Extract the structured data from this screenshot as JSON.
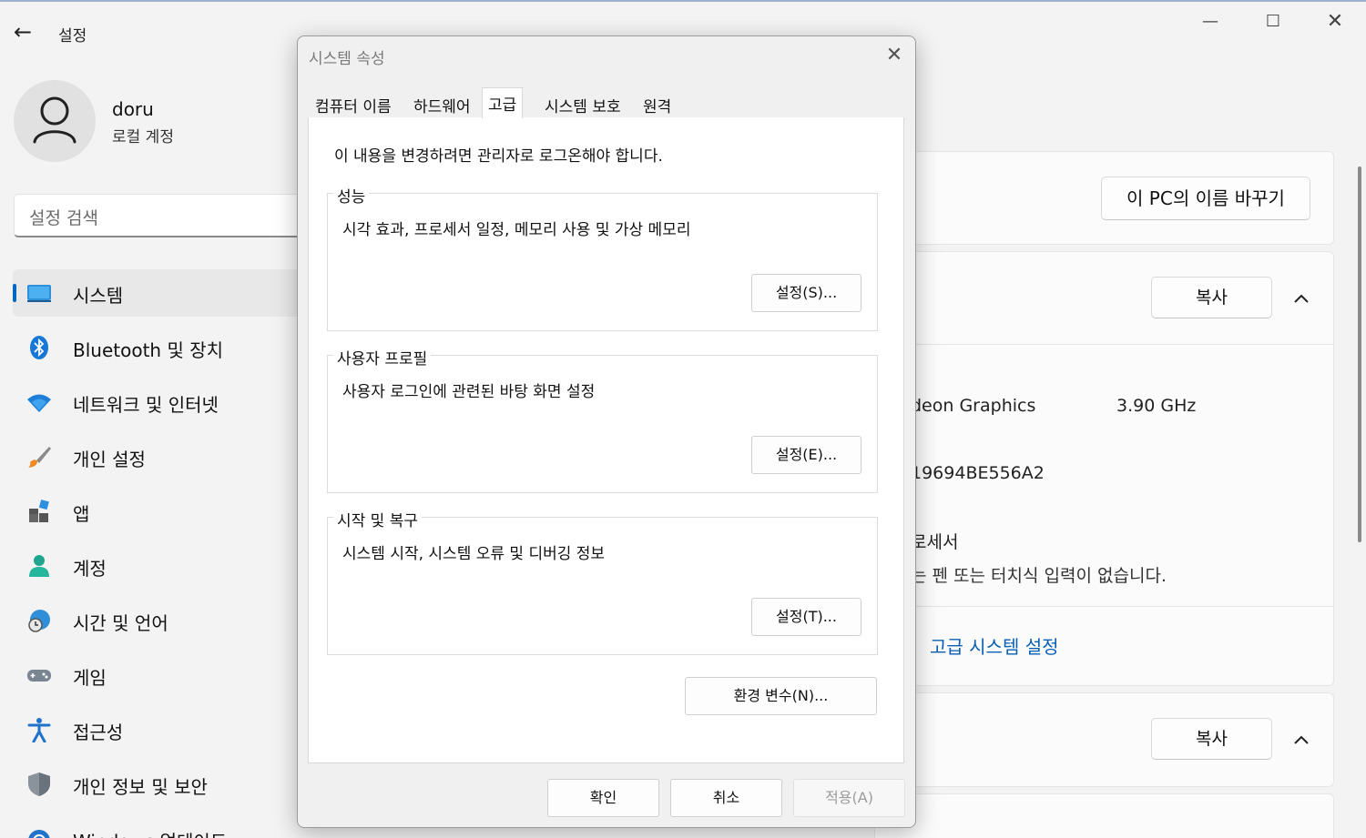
{
  "window": {
    "back_icon": "←",
    "title": "설정",
    "minimize_icon": "—",
    "maximize_icon": "☐",
    "close_icon": "✕"
  },
  "user": {
    "name": "doru",
    "account_type": "로컬 계정"
  },
  "search": {
    "placeholder": "설정 검색"
  },
  "sidebar": {
    "items": [
      {
        "label": "시스템",
        "icon": "system-display-icon",
        "active": true
      },
      {
        "label": "Bluetooth 및 장치",
        "icon": "bluetooth-icon"
      },
      {
        "label": "네트워크 및 인터넷",
        "icon": "wifi-icon"
      },
      {
        "label": "개인 설정",
        "icon": "paintbrush-icon"
      },
      {
        "label": "앱",
        "icon": "apps-icon"
      },
      {
        "label": "계정",
        "icon": "account-icon"
      },
      {
        "label": "시간 및 언어",
        "icon": "globe-clock-icon"
      },
      {
        "label": "게임",
        "icon": "gamepad-icon"
      },
      {
        "label": "접근성",
        "icon": "accessibility-icon"
      },
      {
        "label": "개인 정보 및 보안",
        "icon": "shield-icon"
      },
      {
        "label": "Windows 업데이트",
        "icon": "update-icon"
      }
    ]
  },
  "content": {
    "rename_button": "이 PC의 이름 바꾸기",
    "copy_button_1": "복사",
    "copy_button_2": "복사",
    "spec_graphics": "deon Graphics",
    "spec_speed": "3.90 GHz",
    "spec_id": "19694BE556A2",
    "spec_system_type": "로세서",
    "spec_pen": "는 펜 또는 터치식 입력이 없습니다.",
    "advanced_link": "고급 시스템 설정"
  },
  "dialog": {
    "title": "시스템 속성",
    "close_icon": "✕",
    "tabs": [
      {
        "label": "컴퓨터 이름"
      },
      {
        "label": "하드웨어"
      },
      {
        "label": "고급",
        "active": true
      },
      {
        "label": "시스템 보호"
      },
      {
        "label": "원격"
      }
    ],
    "admin_note": "이 내용을 변경하려면 관리자로 로그온해야 합니다.",
    "groups": [
      {
        "title": "성능",
        "description": "시각 효과, 프로세서 일정, 메모리 사용 및 가상 메모리",
        "button": "설정(S)..."
      },
      {
        "title": "사용자 프로필",
        "description": "사용자 로그인에 관련된 바탕 화면 설정",
        "button": "설정(E)..."
      },
      {
        "title": "시작 및 복구",
        "description": "시스템 시작, 시스템 오류 및 디버깅 정보",
        "button": "설정(T)..."
      }
    ],
    "env_button": "환경 변수(N)...",
    "ok_button": "확인",
    "cancel_button": "취소",
    "apply_button": "적용(A)"
  },
  "colors": {
    "accent": "#0067c0",
    "link": "#0a5fb4",
    "background": "#f3f3f3",
    "dialog_background": "#f0f0f0"
  }
}
